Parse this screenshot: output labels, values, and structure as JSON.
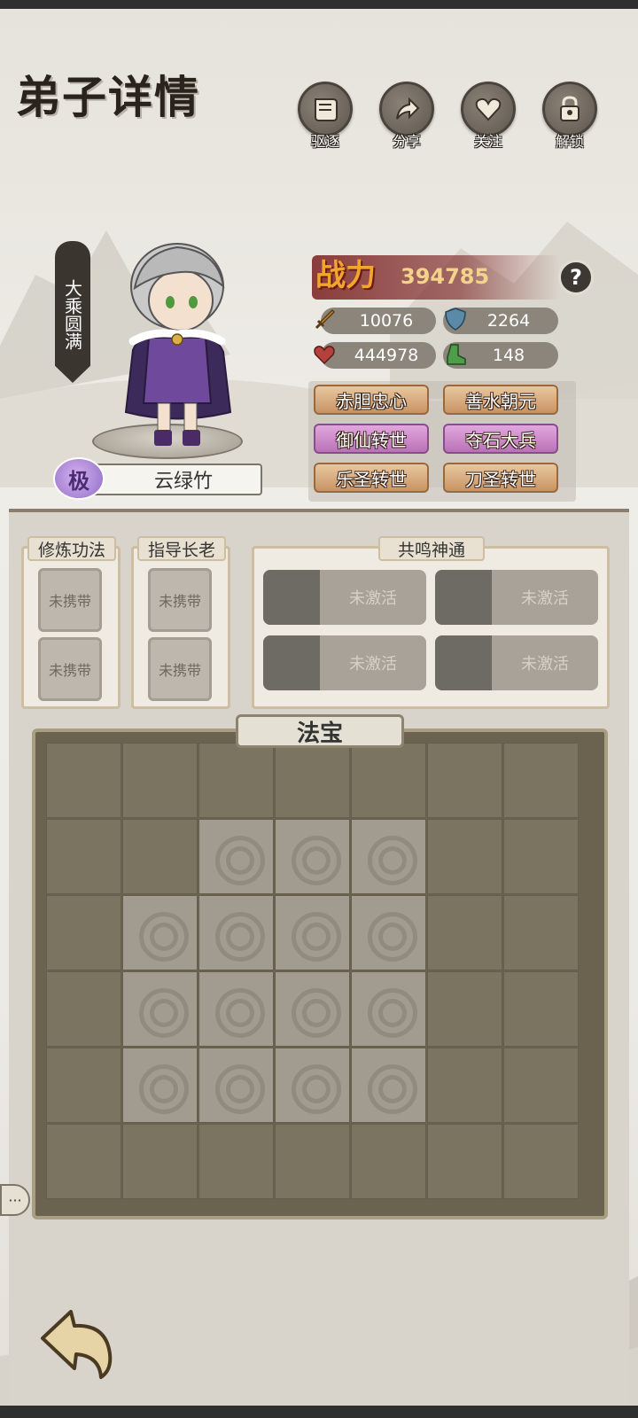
{
  "page": {
    "title": "弟子详情"
  },
  "header_buttons": [
    {
      "id": "expel",
      "label": "驱逐",
      "icon": "scroll-icon"
    },
    {
      "id": "share",
      "label": "分享",
      "icon": "share-arrow-icon"
    },
    {
      "id": "follow",
      "label": "关注",
      "icon": "heart-icon"
    },
    {
      "id": "unlock",
      "label": "解锁",
      "icon": "lock-icon"
    }
  ],
  "disciple": {
    "realm": "大乘圆满",
    "grade": "极",
    "name": "云绿竹"
  },
  "combat": {
    "label": "战力",
    "value": "394785",
    "help": "?"
  },
  "stats": [
    {
      "icon": "sword-icon",
      "value": "10076",
      "color": "#c9893a"
    },
    {
      "icon": "shield-icon",
      "value": "2264",
      "color": "#5a8aa6"
    },
    {
      "icon": "heart-icon",
      "value": "444978",
      "color": "#b3413c"
    },
    {
      "icon": "boot-icon",
      "value": "148",
      "color": "#4f9c4a"
    }
  ],
  "traits": [
    {
      "label": "赤胆忠心",
      "style": "gold"
    },
    {
      "label": "善水朝元",
      "style": "gold"
    },
    {
      "label": "御仙转世",
      "style": "purple"
    },
    {
      "label": "夺石大兵",
      "style": "purple"
    },
    {
      "label": "乐圣转世",
      "style": "gold"
    },
    {
      "label": "刀圣转世",
      "style": "gold"
    }
  ],
  "cultivation": {
    "title": "修炼功法",
    "slots": [
      "未携带",
      "未携带"
    ]
  },
  "mentor": {
    "title": "指导长老",
    "slots": [
      "未携带",
      "未携带"
    ]
  },
  "resonance": {
    "title": "共鸣神通",
    "items": [
      "未激活",
      "未激活",
      "未激活",
      "未激活"
    ]
  },
  "treasure": {
    "title": "法宝",
    "grid": [
      [
        0,
        0,
        0,
        0,
        0,
        0,
        0
      ],
      [
        0,
        0,
        1,
        1,
        1,
        0,
        0
      ],
      [
        0,
        1,
        1,
        1,
        1,
        0,
        0
      ],
      [
        0,
        1,
        1,
        1,
        1,
        0,
        0
      ],
      [
        0,
        1,
        1,
        1,
        1,
        0,
        0
      ],
      [
        0,
        0,
        0,
        0,
        0,
        0,
        0
      ]
    ]
  },
  "chat_button": "···"
}
